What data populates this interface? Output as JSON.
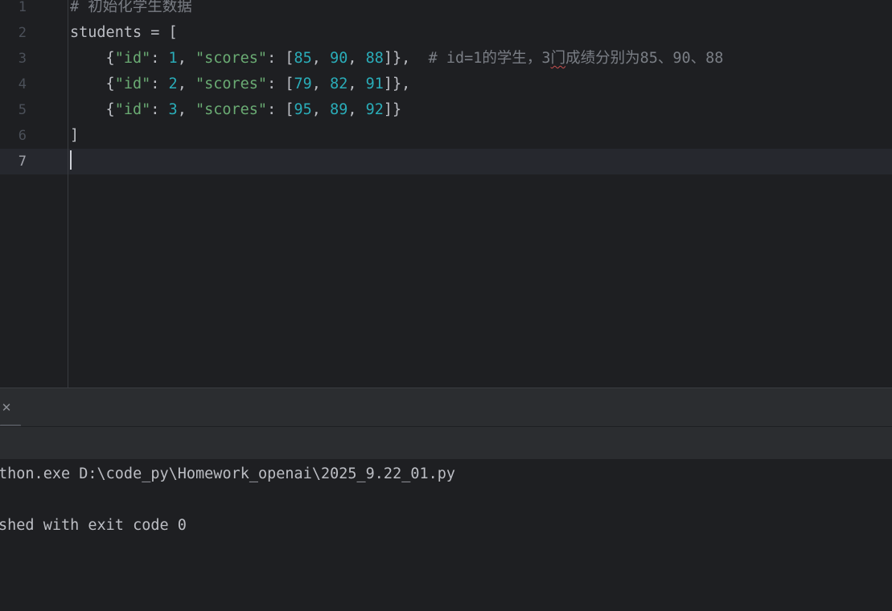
{
  "editor": {
    "lines": [
      {
        "number": "1",
        "tokens": [
          {
            "t": "# 初始化学生数据",
            "k": "comment"
          }
        ]
      },
      {
        "number": "2",
        "tokens": [
          {
            "t": "students = [",
            "k": "plain"
          }
        ]
      },
      {
        "number": "3",
        "tokens": [
          {
            "t": "    {",
            "k": "plain"
          },
          {
            "t": "\"id\"",
            "k": "str"
          },
          {
            "t": ": ",
            "k": "plain"
          },
          {
            "t": "1",
            "k": "num"
          },
          {
            "t": ", ",
            "k": "plain"
          },
          {
            "t": "\"scores\"",
            "k": "str"
          },
          {
            "t": ": [",
            "k": "plain"
          },
          {
            "t": "85",
            "k": "num"
          },
          {
            "t": ", ",
            "k": "plain"
          },
          {
            "t": "90",
            "k": "num"
          },
          {
            "t": ", ",
            "k": "plain"
          },
          {
            "t": "88",
            "k": "num"
          },
          {
            "t": "]},  ",
            "k": "plain"
          },
          {
            "t": "# id=1的学生，3",
            "k": "comment"
          },
          {
            "t": "门",
            "k": "comment-squiggle"
          },
          {
            "t": "成绩分别为85、90、88",
            "k": "comment"
          }
        ]
      },
      {
        "number": "4",
        "tokens": [
          {
            "t": "    {",
            "k": "plain"
          },
          {
            "t": "\"id\"",
            "k": "str"
          },
          {
            "t": ": ",
            "k": "plain"
          },
          {
            "t": "2",
            "k": "num"
          },
          {
            "t": ", ",
            "k": "plain"
          },
          {
            "t": "\"scores\"",
            "k": "str"
          },
          {
            "t": ": [",
            "k": "plain"
          },
          {
            "t": "79",
            "k": "num"
          },
          {
            "t": ", ",
            "k": "plain"
          },
          {
            "t": "82",
            "k": "num"
          },
          {
            "t": ", ",
            "k": "plain"
          },
          {
            "t": "91",
            "k": "num"
          },
          {
            "t": "]},",
            "k": "plain"
          }
        ]
      },
      {
        "number": "5",
        "tokens": [
          {
            "t": "    {",
            "k": "plain"
          },
          {
            "t": "\"id\"",
            "k": "str"
          },
          {
            "t": ": ",
            "k": "plain"
          },
          {
            "t": "3",
            "k": "num"
          },
          {
            "t": ", ",
            "k": "plain"
          },
          {
            "t": "\"scores\"",
            "k": "str"
          },
          {
            "t": ": [",
            "k": "plain"
          },
          {
            "t": "95",
            "k": "num"
          },
          {
            "t": ", ",
            "k": "plain"
          },
          {
            "t": "89",
            "k": "num"
          },
          {
            "t": ", ",
            "k": "plain"
          },
          {
            "t": "92",
            "k": "num"
          },
          {
            "t": "]}",
            "k": "plain"
          }
        ]
      },
      {
        "number": "6",
        "tokens": [
          {
            "t": "]",
            "k": "plain"
          }
        ]
      },
      {
        "number": "7",
        "tokens": [],
        "current": true
      }
    ]
  },
  "run_panel": {
    "close_icon": "close-icon",
    "console_lines": [
      "thon.exe D:\\code_py\\Homework_openai\\2025_9.22_01.py",
      "",
      "shed with exit code 0"
    ]
  },
  "colors": {
    "background": "#1e1f22",
    "comment": "#7a7e85",
    "string": "#6aab73",
    "number": "#2aacb8",
    "text": "#bcbec4",
    "current_line": "#26282e",
    "panel": "#2b2d30"
  }
}
